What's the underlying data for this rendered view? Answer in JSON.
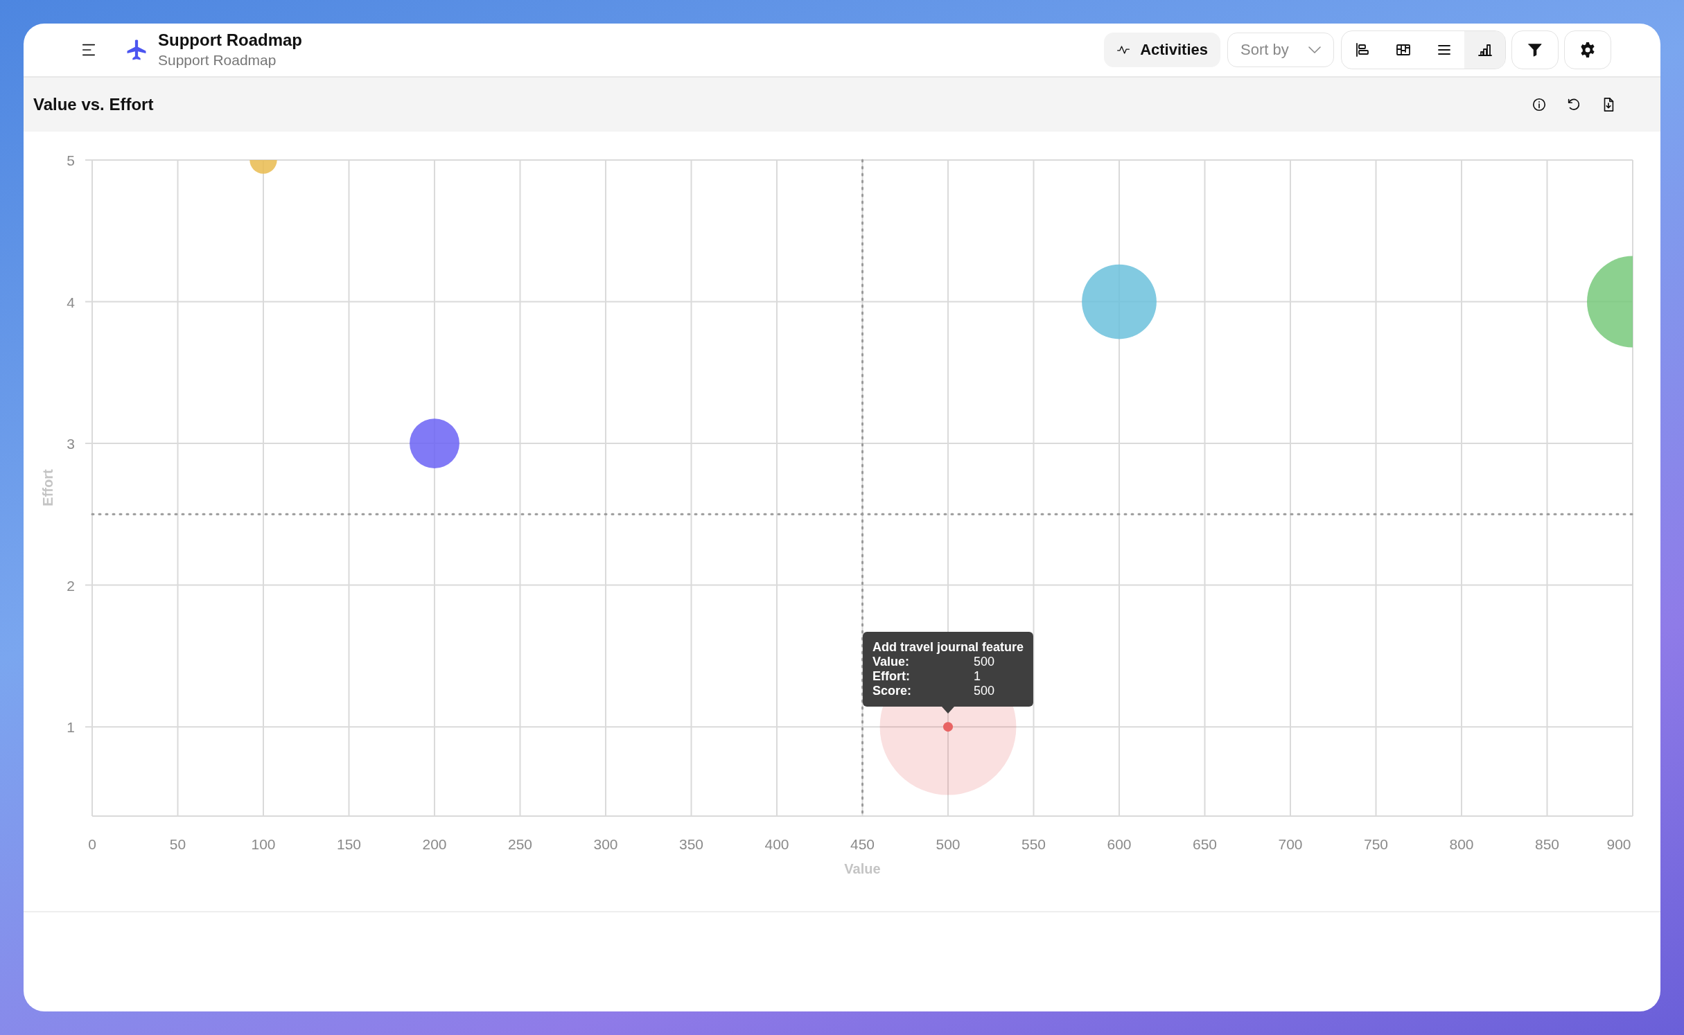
{
  "header": {
    "title": "Support Roadmap",
    "subtitle": "Support Roadmap"
  },
  "toolbar": {
    "activities": "Activities",
    "sort": {
      "placeholder": "Sort by"
    },
    "views": [
      {
        "kind": "timeline",
        "selected": false
      },
      {
        "kind": "board",
        "selected": false
      },
      {
        "kind": "list",
        "selected": false
      },
      {
        "kind": "chart",
        "selected": true
      }
    ]
  },
  "panel": {
    "title": "Value vs. Effort",
    "chart": {
      "chart_data": {
        "type": "scatter",
        "xlabel": "Value",
        "ylabel": "Effort",
        "xlim": [
          0,
          900
        ],
        "ylim": [
          0.37,
          5
        ],
        "xticks": [
          0,
          50,
          100,
          150,
          200,
          250,
          300,
          350,
          400,
          450,
          500,
          550,
          600,
          650,
          700,
          750,
          800,
          850,
          900
        ],
        "yticks": [
          1,
          2,
          3,
          4,
          5
        ],
        "series": [
          {
            "color": "#e9bb4f",
            "x": [
              100
            ],
            "values": [
              5
            ]
          },
          {
            "color": "#6b63f4",
            "x": [
              200
            ],
            "values": [
              3
            ]
          },
          {
            "color": "#6cc1dc",
            "x": [
              600
            ],
            "values": [
              4
            ]
          },
          {
            "color": "#78c97b",
            "x": [
              900
            ],
            "values": [
              4
            ]
          },
          {
            "color": "#e86464",
            "x": [
              500
            ],
            "values": [
              1
            ]
          }
        ],
        "grid": true,
        "ref_lines": [
          {
            "axis": "x",
            "value": 450
          },
          {
            "axis": "y",
            "value": 2.5
          }
        ]
      },
      "points": [
        {
          "selected": false
        },
        {
          "selected": false
        },
        {
          "selected": false
        },
        {
          "selected": false
        },
        {
          "selected": true
        }
      ],
      "tooltip": {
        "title": "Add travel journal feature",
        "rows": [
          {
            "label": "Value:",
            "value": "500"
          },
          {
            "label": "Effort:",
            "value": "1"
          },
          {
            "label": "Score:",
            "value": "500"
          }
        ]
      }
    }
  }
}
